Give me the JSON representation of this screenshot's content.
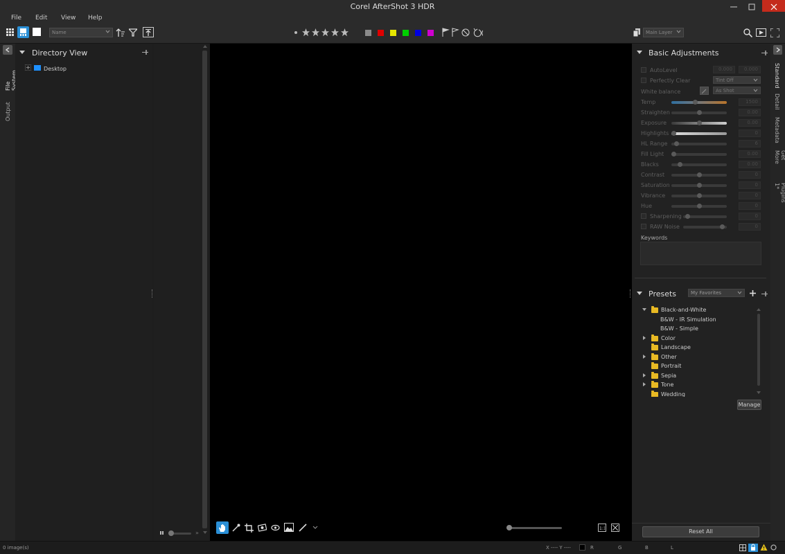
{
  "window": {
    "title": "Corel AfterShot 3 HDR"
  },
  "menu": {
    "file": "File",
    "edit": "Edit",
    "view": "View",
    "help": "Help"
  },
  "toolbar": {
    "sort_value": "Name",
    "layer_value": "Main Layer",
    "color_labels": [
      "#8a8a8a",
      "#e00000",
      "#e6e600",
      "#00d000",
      "#0000e0",
      "#d000d0"
    ]
  },
  "left_tabs": {
    "file_system": "File System",
    "output": "Output"
  },
  "directory": {
    "title": "Directory View",
    "items": [
      {
        "label": "Desktop"
      }
    ]
  },
  "right_tabs": {
    "standard": "Standard",
    "detail": "Detail",
    "metadata": "Metadata",
    "get_more": "Get More",
    "plugins": "Plugins 1*"
  },
  "basic": {
    "title": "Basic Adjustments",
    "autolevel": {
      "label": "AutoLevel",
      "v1": "0.000",
      "v2": "0.000"
    },
    "perfectly_clear": {
      "label": "Perfectly Clear",
      "value": "Tint Off"
    },
    "white_balance": {
      "label": "White balance",
      "value": "As Shot"
    },
    "sliders": [
      {
        "label": "Temp",
        "value": "1500",
        "pos": 0.42
      },
      {
        "label": "Straighten",
        "value": "0.00",
        "pos": 0.5
      },
      {
        "label": "Exposure",
        "value": "0.00",
        "pos": 0.5
      },
      {
        "label": "Highlights",
        "value": "0",
        "pos": 0.0
      },
      {
        "label": "HL Range",
        "value": "6",
        "pos": 0.05
      },
      {
        "label": "Fill Light",
        "value": "0.00",
        "pos": 0.0
      },
      {
        "label": "Blacks",
        "value": "0.00",
        "pos": 0.12
      },
      {
        "label": "Contrast",
        "value": "0",
        "pos": 0.5
      },
      {
        "label": "Saturation",
        "value": "0",
        "pos": 0.5
      },
      {
        "label": "Vibrance",
        "value": "0",
        "pos": 0.5
      },
      {
        "label": "Hue",
        "value": "0",
        "pos": 0.5
      }
    ],
    "sharpening": {
      "label": "Sharpening",
      "value": "0",
      "pos": 0.05
    },
    "raw_noise": {
      "label": "RAW Noise",
      "value": "0",
      "pos": 0.95
    },
    "keywords_label": "Keywords"
  },
  "presets": {
    "title": "Presets",
    "filter_value": "My Favorites",
    "items": [
      {
        "label": "Black-and-White",
        "level": 0,
        "expanded": true,
        "folder": true
      },
      {
        "label": "B&W - IR Simulation",
        "level": 1,
        "folder": false
      },
      {
        "label": "B&W - Simple",
        "level": 1,
        "folder": false
      },
      {
        "label": "Color",
        "level": 0,
        "expanded": false,
        "folder": true,
        "children": true
      },
      {
        "label": "Landscape",
        "level": 0,
        "folder": true
      },
      {
        "label": "Other",
        "level": 0,
        "folder": true,
        "children": true
      },
      {
        "label": "Portrait",
        "level": 0,
        "folder": true
      },
      {
        "label": "Sepia",
        "level": 0,
        "folder": true,
        "children": true
      },
      {
        "label": "Tone",
        "level": 0,
        "folder": true,
        "children": true
      },
      {
        "label": "Wedding",
        "level": 0,
        "folder": true
      }
    ],
    "manage_label": "Manage"
  },
  "reset_all_label": "Reset All",
  "status": {
    "count": "0 image(s)",
    "xy": "X ---- Y ----",
    "r": "R",
    "g": "G",
    "b": "B",
    "l": "L"
  }
}
